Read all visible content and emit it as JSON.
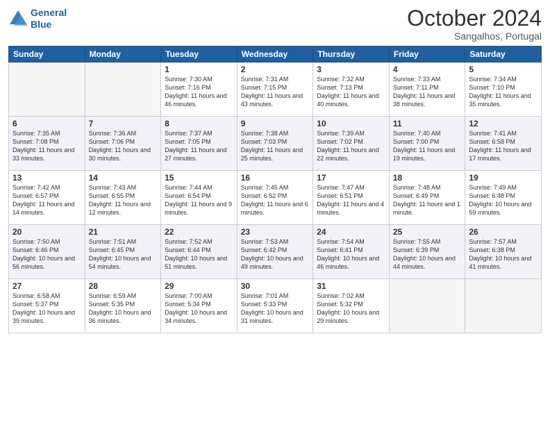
{
  "header": {
    "logo_line1": "General",
    "logo_line2": "Blue",
    "month": "October 2024",
    "location": "Sangalhos, Portugal"
  },
  "weekdays": [
    "Sunday",
    "Monday",
    "Tuesday",
    "Wednesday",
    "Thursday",
    "Friday",
    "Saturday"
  ],
  "weeks": [
    [
      {
        "day": "",
        "empty": true
      },
      {
        "day": "",
        "empty": true
      },
      {
        "day": "1",
        "sunrise": "Sunrise: 7:30 AM",
        "sunset": "Sunset: 7:16 PM",
        "daylight": "Daylight: 11 hours and 46 minutes."
      },
      {
        "day": "2",
        "sunrise": "Sunrise: 7:31 AM",
        "sunset": "Sunset: 7:15 PM",
        "daylight": "Daylight: 11 hours and 43 minutes."
      },
      {
        "day": "3",
        "sunrise": "Sunrise: 7:32 AM",
        "sunset": "Sunset: 7:13 PM",
        "daylight": "Daylight: 11 hours and 40 minutes."
      },
      {
        "day": "4",
        "sunrise": "Sunrise: 7:33 AM",
        "sunset": "Sunset: 7:11 PM",
        "daylight": "Daylight: 11 hours and 38 minutes."
      },
      {
        "day": "5",
        "sunrise": "Sunrise: 7:34 AM",
        "sunset": "Sunset: 7:10 PM",
        "daylight": "Daylight: 11 hours and 35 minutes."
      }
    ],
    [
      {
        "day": "6",
        "sunrise": "Sunrise: 7:35 AM",
        "sunset": "Sunset: 7:08 PM",
        "daylight": "Daylight: 11 hours and 33 minutes."
      },
      {
        "day": "7",
        "sunrise": "Sunrise: 7:36 AM",
        "sunset": "Sunset: 7:06 PM",
        "daylight": "Daylight: 11 hours and 30 minutes."
      },
      {
        "day": "8",
        "sunrise": "Sunrise: 7:37 AM",
        "sunset": "Sunset: 7:05 PM",
        "daylight": "Daylight: 11 hours and 27 minutes."
      },
      {
        "day": "9",
        "sunrise": "Sunrise: 7:38 AM",
        "sunset": "Sunset: 7:03 PM",
        "daylight": "Daylight: 11 hours and 25 minutes."
      },
      {
        "day": "10",
        "sunrise": "Sunrise: 7:39 AM",
        "sunset": "Sunset: 7:02 PM",
        "daylight": "Daylight: 11 hours and 22 minutes."
      },
      {
        "day": "11",
        "sunrise": "Sunrise: 7:40 AM",
        "sunset": "Sunset: 7:00 PM",
        "daylight": "Daylight: 11 hours and 19 minutes."
      },
      {
        "day": "12",
        "sunrise": "Sunrise: 7:41 AM",
        "sunset": "Sunset: 6:58 PM",
        "daylight": "Daylight: 11 hours and 17 minutes."
      }
    ],
    [
      {
        "day": "13",
        "sunrise": "Sunrise: 7:42 AM",
        "sunset": "Sunset: 6:57 PM",
        "daylight": "Daylight: 11 hours and 14 minutes."
      },
      {
        "day": "14",
        "sunrise": "Sunrise: 7:43 AM",
        "sunset": "Sunset: 6:55 PM",
        "daylight": "Daylight: 11 hours and 12 minutes."
      },
      {
        "day": "15",
        "sunrise": "Sunrise: 7:44 AM",
        "sunset": "Sunset: 6:54 PM",
        "daylight": "Daylight: 11 hours and 9 minutes."
      },
      {
        "day": "16",
        "sunrise": "Sunrise: 7:45 AM",
        "sunset": "Sunset: 6:52 PM",
        "daylight": "Daylight: 11 hours and 6 minutes."
      },
      {
        "day": "17",
        "sunrise": "Sunrise: 7:47 AM",
        "sunset": "Sunset: 6:51 PM",
        "daylight": "Daylight: 11 hours and 4 minutes."
      },
      {
        "day": "18",
        "sunrise": "Sunrise: 7:48 AM",
        "sunset": "Sunset: 6:49 PM",
        "daylight": "Daylight: 11 hours and 1 minute."
      },
      {
        "day": "19",
        "sunrise": "Sunrise: 7:49 AM",
        "sunset": "Sunset: 6:48 PM",
        "daylight": "Daylight: 10 hours and 59 minutes."
      }
    ],
    [
      {
        "day": "20",
        "sunrise": "Sunrise: 7:50 AM",
        "sunset": "Sunset: 6:46 PM",
        "daylight": "Daylight: 10 hours and 56 minutes."
      },
      {
        "day": "21",
        "sunrise": "Sunrise: 7:51 AM",
        "sunset": "Sunset: 6:45 PM",
        "daylight": "Daylight: 10 hours and 54 minutes."
      },
      {
        "day": "22",
        "sunrise": "Sunrise: 7:52 AM",
        "sunset": "Sunset: 6:44 PM",
        "daylight": "Daylight: 10 hours and 51 minutes."
      },
      {
        "day": "23",
        "sunrise": "Sunrise: 7:53 AM",
        "sunset": "Sunset: 6:42 PM",
        "daylight": "Daylight: 10 hours and 49 minutes."
      },
      {
        "day": "24",
        "sunrise": "Sunrise: 7:54 AM",
        "sunset": "Sunset: 6:41 PM",
        "daylight": "Daylight: 10 hours and 46 minutes."
      },
      {
        "day": "25",
        "sunrise": "Sunrise: 7:55 AM",
        "sunset": "Sunset: 6:39 PM",
        "daylight": "Daylight: 10 hours and 44 minutes."
      },
      {
        "day": "26",
        "sunrise": "Sunrise: 7:57 AM",
        "sunset": "Sunset: 6:38 PM",
        "daylight": "Daylight: 10 hours and 41 minutes."
      }
    ],
    [
      {
        "day": "27",
        "sunrise": "Sunrise: 6:58 AM",
        "sunset": "Sunset: 5:37 PM",
        "daylight": "Daylight: 10 hours and 39 minutes."
      },
      {
        "day": "28",
        "sunrise": "Sunrise: 6:59 AM",
        "sunset": "Sunset: 5:35 PM",
        "daylight": "Daylight: 10 hours and 36 minutes."
      },
      {
        "day": "29",
        "sunrise": "Sunrise: 7:00 AM",
        "sunset": "Sunset: 5:34 PM",
        "daylight": "Daylight: 10 hours and 34 minutes."
      },
      {
        "day": "30",
        "sunrise": "Sunrise: 7:01 AM",
        "sunset": "Sunset: 5:33 PM",
        "daylight": "Daylight: 10 hours and 31 minutes."
      },
      {
        "day": "31",
        "sunrise": "Sunrise: 7:02 AM",
        "sunset": "Sunset: 5:32 PM",
        "daylight": "Daylight: 10 hours and 29 minutes."
      },
      {
        "day": "",
        "empty": true
      },
      {
        "day": "",
        "empty": true
      }
    ]
  ]
}
